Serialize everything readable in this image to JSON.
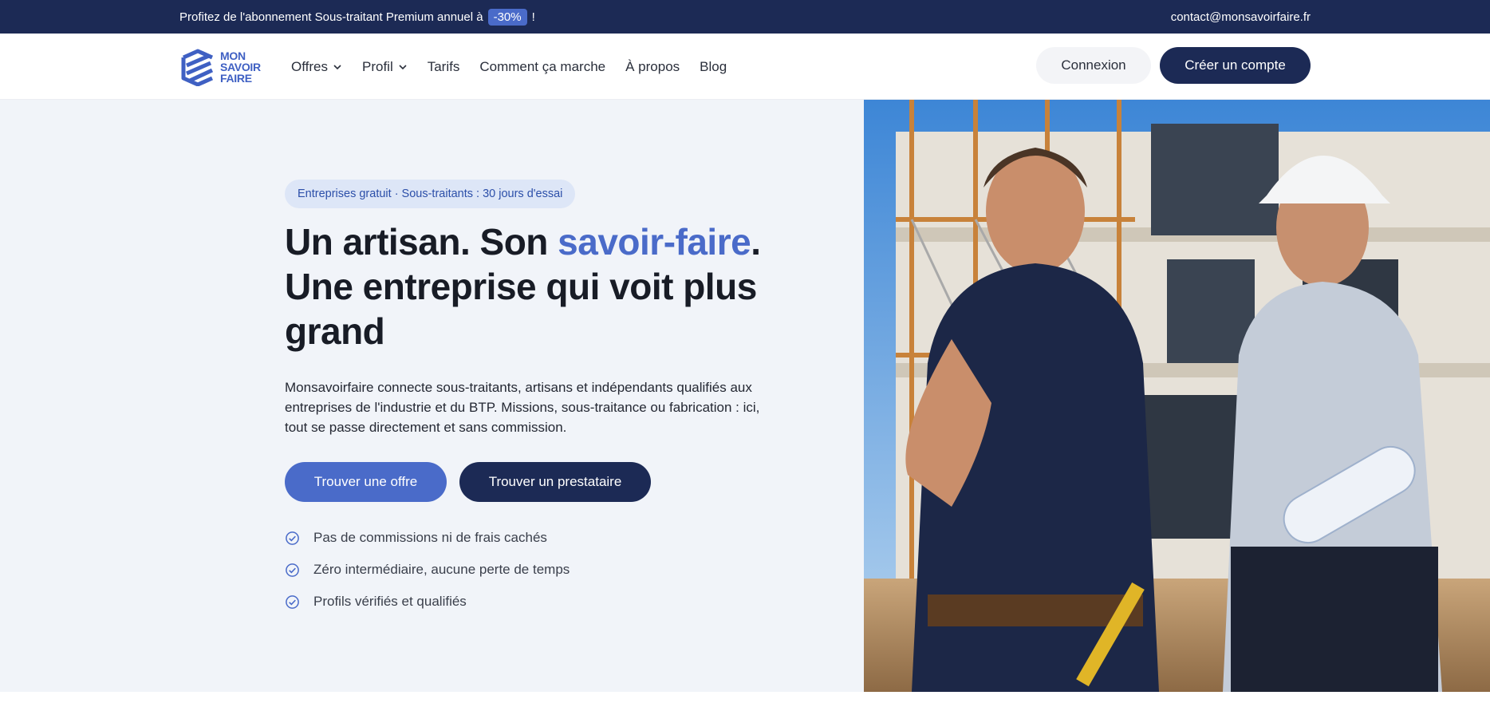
{
  "promo": {
    "text_before": "Profitez de l'abonnement Sous-traitant Premium annuel à",
    "discount": "-30%",
    "text_after": "!",
    "contact_email": "contact@monsavoirfaire.fr"
  },
  "logo": {
    "line1": "MON",
    "line2": "SAVOIR",
    "line3": "FAIRE"
  },
  "nav": {
    "items": [
      {
        "label": "Offres",
        "has_dropdown": true
      },
      {
        "label": "Profil",
        "has_dropdown": true
      },
      {
        "label": "Tarifs"
      },
      {
        "label": "Comment ça marche"
      },
      {
        "label": "À propos"
      },
      {
        "label": "Blog"
      }
    ],
    "login_label": "Connexion",
    "signup_label": "Créer un compte"
  },
  "hero": {
    "pill": "Entreprises gratuit · Sous-traitants : 30 jours d'essai",
    "headline_part1": "Un artisan. Son ",
    "headline_accent": "savoir-faire",
    "headline_part2": ". Une entreprise qui voit plus grand",
    "description": "Monsavoirfaire connecte sous-traitants, artisans et indépendants qualifiés aux entreprises de l'industrie et du BTP. Missions, sous-traitance ou fabrication : ici, tout se passe directement et sans commission.",
    "cta_primary": "Trouver une offre",
    "cta_secondary": "Trouver un prestataire",
    "checks": [
      "Pas de commissions ni de frais cachés",
      "Zéro intermédiaire, aucune perte de temps",
      "Profils vérifiés et qualifiés"
    ]
  },
  "colors": {
    "navy": "#1c2a55",
    "accent": "#4a6bc9",
    "hero_bg": "#f1f4f9"
  }
}
